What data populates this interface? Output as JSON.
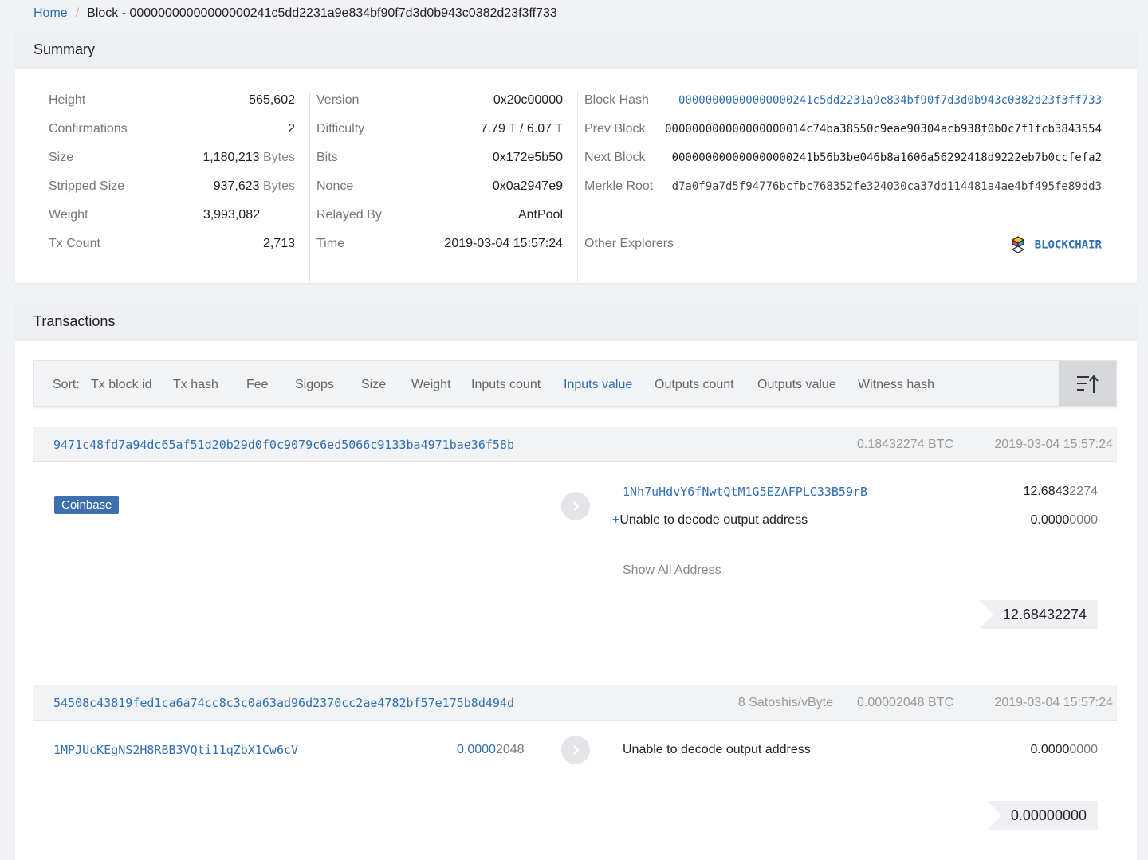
{
  "breadcrumb": {
    "home": "Home",
    "sep": "/",
    "current": "Block - 00000000000000000241c5dd2231a9e834bf90f7d3d0b943c0382d23f3ff733"
  },
  "summary": {
    "title": "Summary",
    "col1": [
      {
        "label": "Height",
        "value": "565,602",
        "unit": ""
      },
      {
        "label": "Confirmations",
        "value": "2",
        "unit": ""
      },
      {
        "label": "Size",
        "value": "1,180,213",
        "unit": "Bytes"
      },
      {
        "label": "Stripped Size",
        "value": "937,623",
        "unit": "Bytes"
      },
      {
        "label": "Weight",
        "value": "3,993,082",
        "unit": ""
      },
      {
        "label": "Tx Count",
        "value": "2,713",
        "unit": ""
      }
    ],
    "col2": [
      {
        "label": "Version",
        "value": "0x20c00000"
      },
      {
        "label": "Difficulty",
        "value_a": "7.79",
        "unit_a": "T",
        "slash": "/",
        "value_b": "6.07",
        "unit_b": "T"
      },
      {
        "label": "Bits",
        "value": "0x172e5b50"
      },
      {
        "label": "Nonce",
        "value": "0x0a2947e9"
      },
      {
        "label": "Relayed By",
        "value": "AntPool"
      },
      {
        "label": "Time",
        "value": "2019-03-04 15:57:24"
      }
    ],
    "col3": [
      {
        "label": "Block Hash",
        "value": "00000000000000000241c5dd2231a9e834bf90f7d3d0b943c0382d23f3ff733"
      },
      {
        "label": "Prev Block",
        "value": "000000000000000000014c74ba38550c9eae90304acb938f0b0c7f1fcb3843554"
      },
      {
        "label": "Next Block",
        "value": "000000000000000000241b56b3be046b8a1606a56292418d9222eb7b0ccfefa2"
      },
      {
        "label": "Merkle Root",
        "value": "d7a0f9a7d5f94776bcfbc768352fe324030ca37dd114481a4ae4bf495fe89dd3"
      },
      {
        "label": "Other Explorers",
        "value": "BLOCKCHAIR"
      }
    ]
  },
  "transactions": {
    "title": "Transactions",
    "sort_label": "Sort:",
    "sort_items": [
      "Tx block id",
      "Tx hash",
      "Fee",
      "Sigops",
      "Size",
      "Weight",
      "Inputs count",
      "Inputs value",
      "Outputs count",
      "Outputs value",
      "Witness hash"
    ],
    "active_sort": "Inputs value",
    "list": [
      {
        "hash": "9471c48fd7a94dc65af51d20b29d0f0c9079c6ed5066c9133ba4971bae36f58b",
        "fee_rate": "",
        "amount": "0.18432274 BTC",
        "time": "2019-03-04 15:57:24",
        "input_badge": "Coinbase",
        "outputs": [
          {
            "plus": "",
            "address": "1Nh7uHdvY6fNwtQtM1G5EZAFPLC33B59rB",
            "amount_strong": "12.6843",
            "amount_faint": "2274"
          },
          {
            "plus": "+",
            "address": "Unable to decode output address",
            "amount_strong": "0.0000",
            "amount_faint": "0000"
          }
        ],
        "show_all": "Show All Address",
        "total": "12.68432274"
      },
      {
        "hash": "54508c43819fed1ca6a74cc8c3c0a63ad96d2370cc2ae4782bf57e175b8d494d",
        "fee_rate": "8 Satoshis/vByte",
        "amount": "0.00002048 BTC",
        "time": "2019-03-04 15:57:24",
        "input_address": "1MPJUcKEgNS2H8RBB3VQti11qZbX1Cw6cV",
        "input_amount_blue": "0.0000",
        "input_amount_faint": "2048",
        "outputs": [
          {
            "plus": "",
            "address": "Unable to decode output address",
            "amount_strong": "0.0000",
            "amount_faint": "0000"
          }
        ],
        "total": "0.00000000"
      }
    ]
  },
  "colors": {
    "accent": "#2f6fb3",
    "badge": "#3e6fae",
    "panel_head": "#eef0f3"
  }
}
